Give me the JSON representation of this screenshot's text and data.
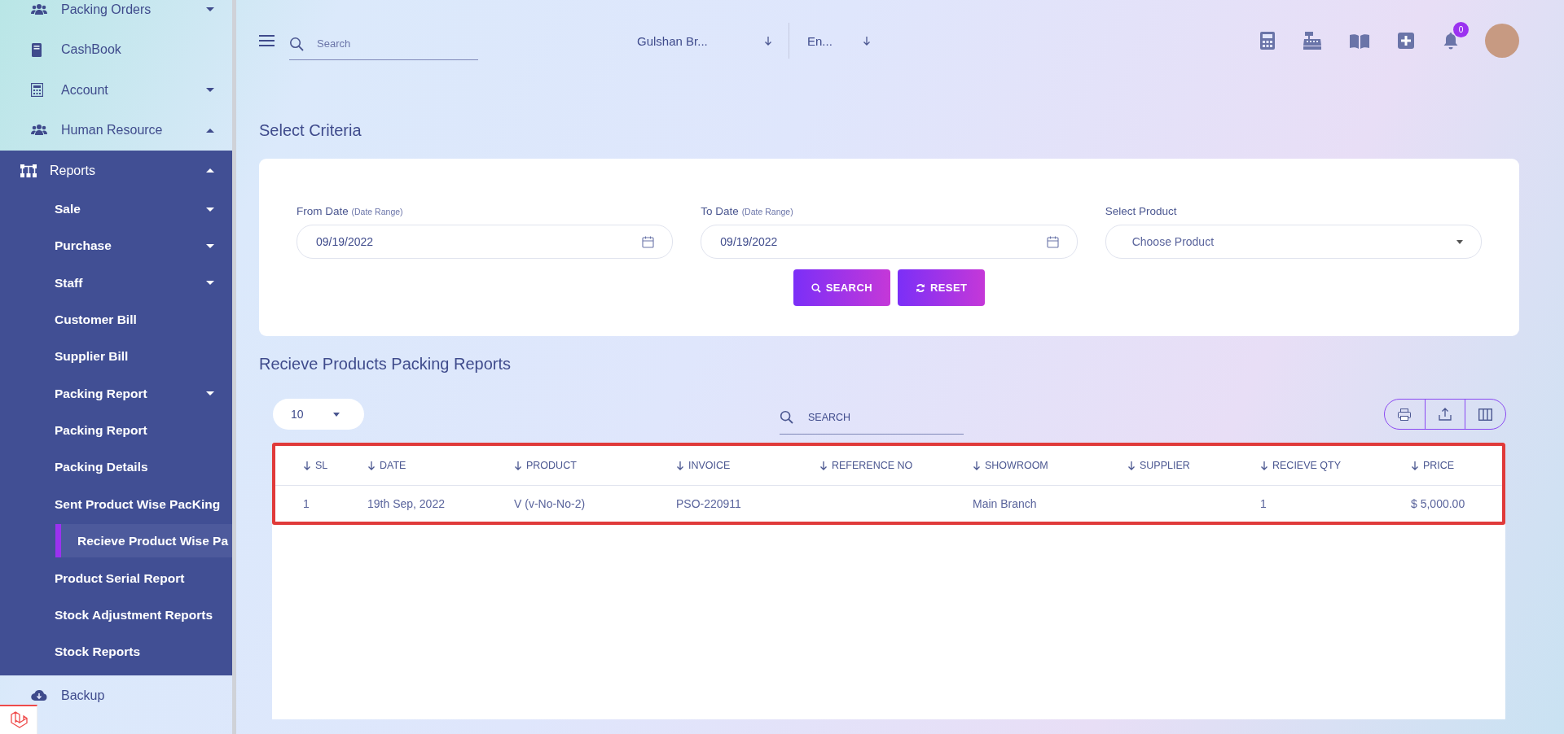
{
  "sidebar": {
    "items": [
      {
        "label": "Packing Orders",
        "kind": "group",
        "expanded": false
      },
      {
        "label": "CashBook",
        "kind": "link"
      },
      {
        "label": "Account",
        "kind": "group",
        "expanded": false
      },
      {
        "label": "Human Resource",
        "kind": "group",
        "expanded": true
      },
      {
        "label": "Reports",
        "kind": "section",
        "expanded": true,
        "children": [
          {
            "label": "Sale",
            "kind": "group",
            "expanded": false,
            "selected": false
          },
          {
            "label": "Purchase",
            "kind": "group",
            "expanded": false,
            "selected": false
          },
          {
            "label": "Staff",
            "kind": "group",
            "expanded": false,
            "selected": false
          },
          {
            "label": "Customer Bill",
            "kind": "link",
            "selected": false
          },
          {
            "label": "Supplier Bill",
            "kind": "link",
            "selected": false
          },
          {
            "label": "Packing Report",
            "kind": "group",
            "expanded": false,
            "selected": false
          },
          {
            "label": "Packing Report",
            "kind": "link",
            "selected": false
          },
          {
            "label": "Packing Details",
            "kind": "link",
            "selected": false
          },
          {
            "label": "Sent Product Wise PacKing",
            "kind": "link",
            "selected": false
          },
          {
            "label": "Recieve Product Wise Pa",
            "kind": "link",
            "selected": true
          },
          {
            "label": "Product Serial Report",
            "kind": "link",
            "selected": false
          },
          {
            "label": "Stock Adjustment Reports",
            "kind": "link",
            "selected": false
          },
          {
            "label": "Stock Reports",
            "kind": "link",
            "selected": false
          }
        ]
      },
      {
        "label": "Backup",
        "kind": "link"
      }
    ]
  },
  "topbar": {
    "search": {
      "placeholder": "Search"
    },
    "branch": "Gulshan Br...",
    "language": "En...",
    "notification_count": "0"
  },
  "criteria": {
    "title": "Select Criteria",
    "fields": [
      {
        "kind": "date",
        "label": "From Date",
        "hint": "(Date Range)",
        "value": "09/19/2022"
      },
      {
        "kind": "date",
        "label": "To Date",
        "hint": "(Date Range)",
        "value": "09/19/2022"
      },
      {
        "kind": "select",
        "label": "Select Product",
        "placeholder": "Choose Product"
      }
    ],
    "buttons": [
      {
        "kind": "search",
        "label": "SEARCH"
      },
      {
        "kind": "reset",
        "label": "RESET"
      }
    ]
  },
  "report": {
    "title": "Recieve Products Packing Reports",
    "page_size": "10",
    "search": {
      "placeholder": "SEARCH"
    },
    "table": {
      "columns": [
        "SL",
        "DATE",
        "PRODUCT",
        "INVOICE",
        "REFERENCE NO",
        "SHOWROOM",
        "SUPPLIER",
        "RECIEVE QTY",
        "PRICE"
      ],
      "rows": [
        [
          "1",
          "19th Sep, 2022",
          "V (v-No-No-2)",
          "PSO-220911",
          "",
          "Main Branch",
          "",
          "1",
          "$ 5,000.00"
        ]
      ]
    }
  }
}
